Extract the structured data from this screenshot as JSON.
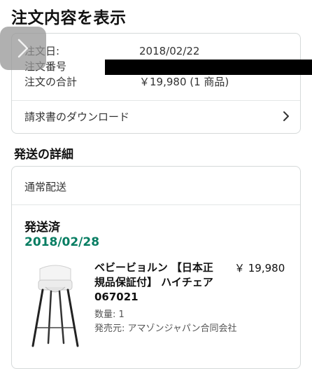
{
  "page": {
    "title": "注文内容を表示"
  },
  "summary": {
    "order_date_label": "注文日:",
    "order_date_value": "2018/02/22",
    "order_number_label": "注文番号",
    "order_total_label": "注文の合計",
    "order_total_value": "￥19,980 (1 商品)",
    "invoice_download_label": "請求書のダウンロード"
  },
  "shipping": {
    "section_title": "発送の詳細",
    "method": "通常配送",
    "status": "発送済",
    "date": "2018/02/28",
    "item": {
      "title": "ベビービョルン 【日本正規品保証付】 ハイチェア 067021",
      "price": "￥ 19,980",
      "quantity": "数量: 1",
      "seller": "発売元: アマゾンジャパン合同会社"
    }
  },
  "icons": {
    "back": "chevron-right-icon",
    "invoice_chevron": "chevron-right-icon"
  },
  "colors": {
    "date_green": "#067d62",
    "border": "#d5d9d9"
  }
}
